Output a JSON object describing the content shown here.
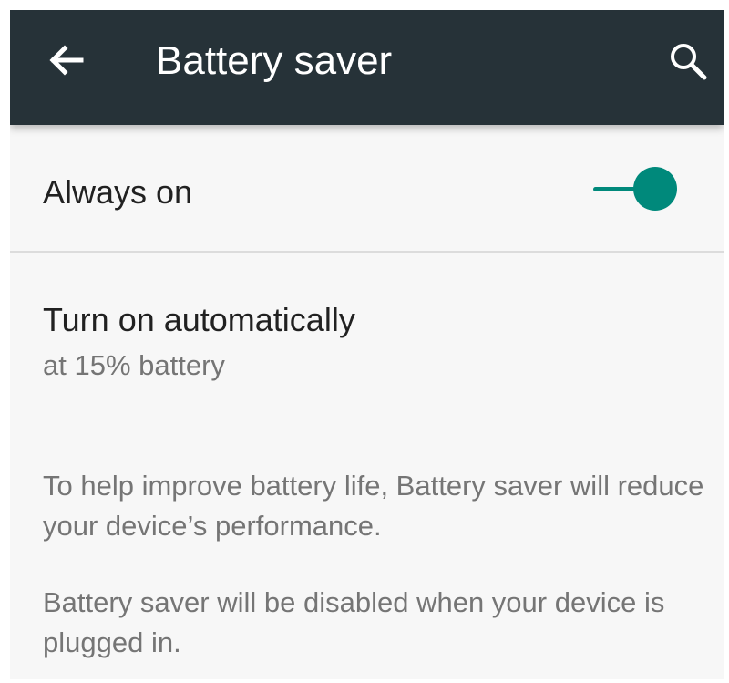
{
  "app_bar": {
    "title": "Battery saver",
    "back_icon": "arrow-left-icon",
    "search_icon": "search-icon",
    "background": "#263238"
  },
  "settings": {
    "always_on": {
      "label": "Always on",
      "checked": true,
      "accent": "#00897b"
    },
    "turn_on_automatically": {
      "title": "Turn on automatically",
      "summary": "at 15% battery"
    }
  },
  "info": {
    "line1": "To help improve battery life, Battery saver will reduce your device’s performance.",
    "line2": "Battery saver will be disabled when your device is plugged in."
  }
}
